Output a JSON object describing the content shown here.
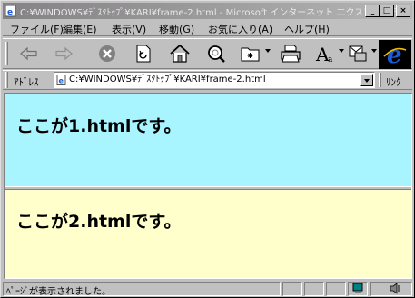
{
  "window": {
    "title": "C:¥WINDOWS¥ﾃﾞｽｸﾄｯﾌﾟ¥KARI¥frame-2.html - Microsoft インターネット エクスプローラ",
    "minimize_label": "_",
    "maximize_label": "□",
    "close_label": "×"
  },
  "menu": {
    "items": [
      {
        "label": "ファイル(F)"
      },
      {
        "label": "編集(E)"
      },
      {
        "label": "表示(V)"
      },
      {
        "label": "移動(G)"
      },
      {
        "label": "お気に入り(A)"
      },
      {
        "label": "ヘルプ(H)"
      }
    ]
  },
  "toolbar": {
    "icons": [
      "back-arrow-icon",
      "forward-arrow-icon",
      "stop-icon",
      "refresh-icon",
      "home-icon",
      "search-icon",
      "history-icon",
      "print-icon",
      "font-icon",
      "mail-icon",
      "ie-logo-icon"
    ],
    "accent": "#1a5bd8"
  },
  "address": {
    "label": "ｱﾄﾞﾚｽ",
    "value": "C:¥WINDOWS¥ﾃﾞｽｸﾄｯﾌﾟ¥KARI¥frame-2.html",
    "links_label": "ﾘﾝｸ"
  },
  "frames": {
    "top": {
      "text": "ここが1.htmlです。",
      "background": "#a8f4ff"
    },
    "bottom": {
      "text": "ここが2.htmlです。",
      "background": "#ffffcc"
    }
  },
  "status": {
    "text": "ﾍﾟｰｼﾞが表示されました。"
  }
}
